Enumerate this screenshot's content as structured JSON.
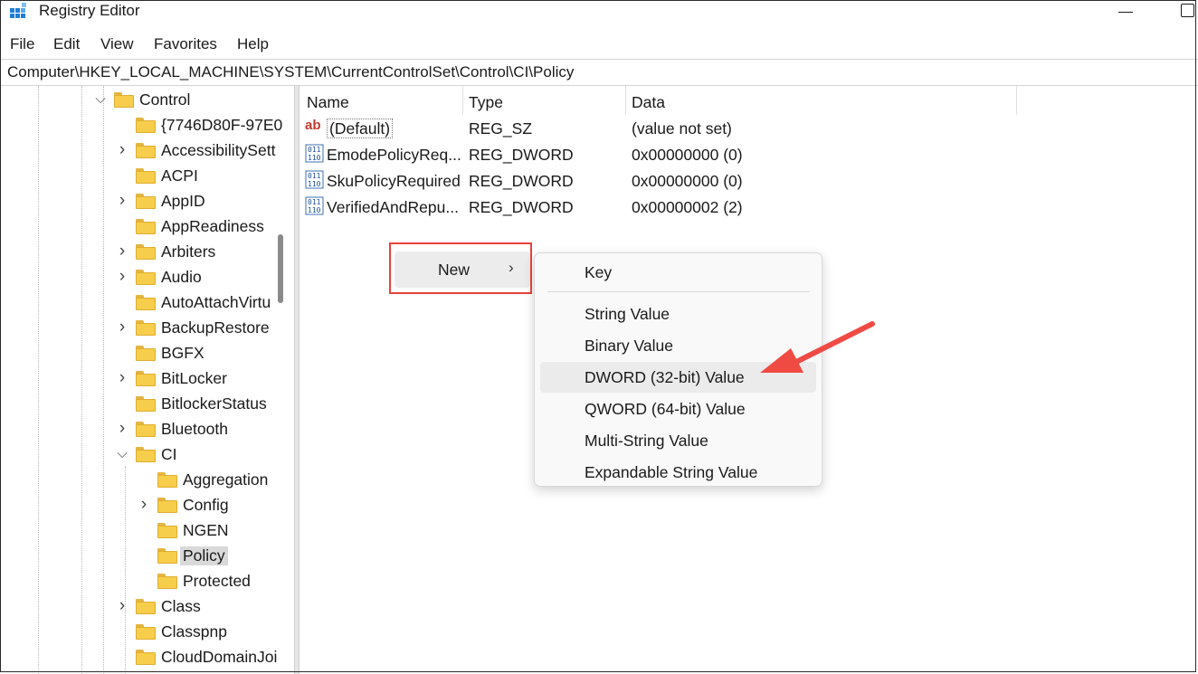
{
  "window": {
    "title": "Registry Editor",
    "minimize_icon": "minimize-icon",
    "maximize_icon": "maximize-icon"
  },
  "menu": [
    "File",
    "Edit",
    "View",
    "Favorites",
    "Help"
  ],
  "address": {
    "path": "Computer\\HKEY_LOCAL_MACHINE\\SYSTEM\\CurrentControlSet\\Control\\CI\\Policy"
  },
  "tree": {
    "items": [
      {
        "label": "Control",
        "expander": "expanded"
      },
      {
        "label": "{7746D80F-97E0",
        "expander": "none"
      },
      {
        "label": "AccessibilitySett",
        "expander": "collapsed"
      },
      {
        "label": "ACPI",
        "expander": "none"
      },
      {
        "label": "AppID",
        "expander": "collapsed"
      },
      {
        "label": "AppReadiness",
        "expander": "none"
      },
      {
        "label": "Arbiters",
        "expander": "collapsed"
      },
      {
        "label": "Audio",
        "expander": "collapsed"
      },
      {
        "label": "AutoAttachVirtu",
        "expander": "none"
      },
      {
        "label": "BackupRestore",
        "expander": "collapsed"
      },
      {
        "label": "BGFX",
        "expander": "none"
      },
      {
        "label": "BitLocker",
        "expander": "collapsed"
      },
      {
        "label": "BitlockerStatus",
        "expander": "none"
      },
      {
        "label": "Bluetooth",
        "expander": "collapsed"
      },
      {
        "label": "CI",
        "expander": "expanded"
      },
      {
        "label": "Aggregation",
        "expander": "none"
      },
      {
        "label": "Config",
        "expander": "collapsed"
      },
      {
        "label": "NGEN",
        "expander": "none"
      },
      {
        "label": "Policy",
        "expander": "none",
        "selected": true
      },
      {
        "label": "Protected",
        "expander": "none"
      },
      {
        "label": "Class",
        "expander": "collapsed"
      },
      {
        "label": "Classpnp",
        "expander": "none"
      },
      {
        "label": "CloudDomainJoi",
        "expander": "none"
      }
    ]
  },
  "list": {
    "columns": {
      "name": "Name",
      "type": "Type",
      "data": "Data"
    },
    "rows": [
      {
        "name": "(Default)",
        "type": "REG_SZ",
        "data": "(value not set)",
        "icon": "string-value-icon"
      },
      {
        "name": "EmodePolicyReq...",
        "type": "REG_DWORD",
        "data": "0x00000000 (0)",
        "icon": "binary-value-icon"
      },
      {
        "name": "SkuPolicyRequired",
        "type": "REG_DWORD",
        "data": "0x00000000 (0)",
        "icon": "binary-value-icon"
      },
      {
        "name": "VerifiedAndRepu...",
        "type": "REG_DWORD",
        "data": "0x00000002 (2)",
        "icon": "binary-value-icon"
      }
    ]
  },
  "context_menu": {
    "new_label": "New",
    "submenu": [
      "Key",
      "String Value",
      "Binary Value",
      "DWORD (32-bit) Value",
      "QWORD (64-bit) Value",
      "Multi-String Value",
      "Expandable String Value"
    ],
    "highlighted": "DWORD (32-bit) Value"
  },
  "colors": {
    "highlight_box": "#e8433a",
    "annotation_arrow": "#ef4b43",
    "folder": "#f7cd4c"
  }
}
